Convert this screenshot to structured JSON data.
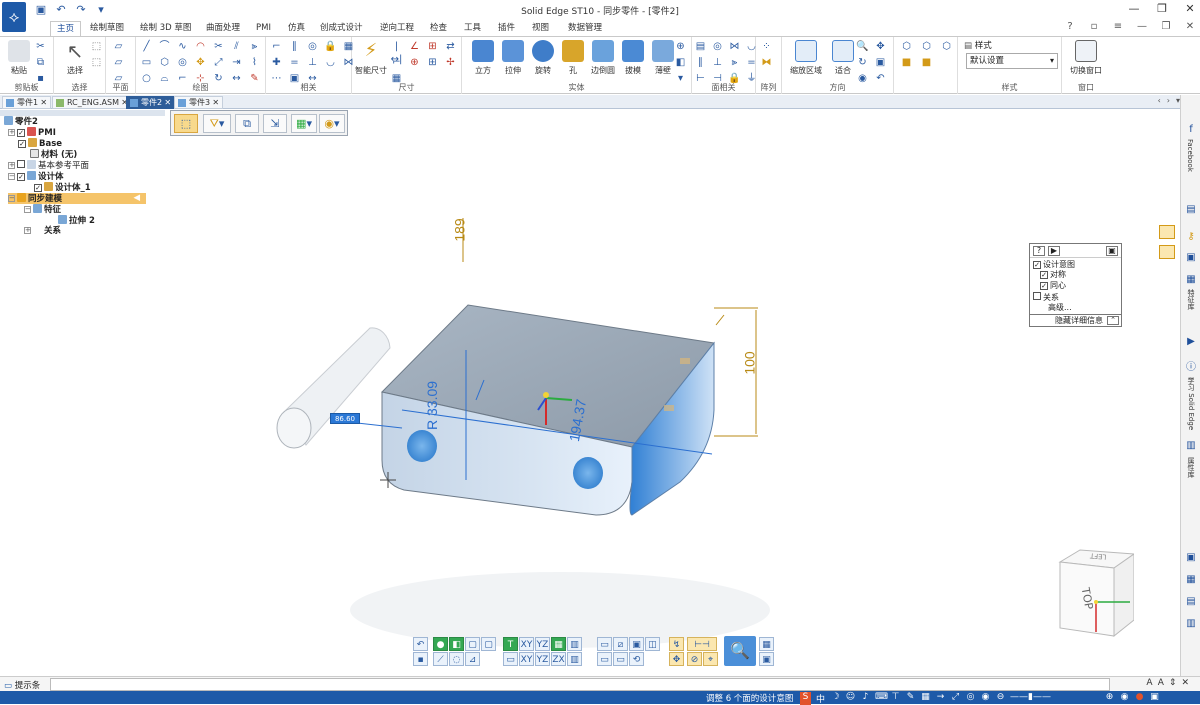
{
  "app": {
    "window_title": "Solid Edge ST10 - 同步零件 - [零件2]",
    "logo_icon": "solid-edge-logo"
  },
  "ribbon_tabs": [
    "主页",
    "绘制草图",
    "绘制 3D 草图",
    "曲面处理",
    "PMI",
    "仿真",
    "创成式设计",
    "逆向工程",
    "检查",
    "工具",
    "插件",
    "视图",
    "数据管理"
  ],
  "ribbon": {
    "groups": {
      "clipboard": "剪贴板",
      "select": "选择",
      "plane": "平面",
      "draw": "绘图",
      "relate": "相关",
      "dimension": "尺寸",
      "solid": "实体",
      "face_relate": "面相关",
      "pattern": "阵列",
      "orient": "方向",
      "style": "样式",
      "window": "窗口"
    },
    "buttons": {
      "paste": "粘贴",
      "select": "选择",
      "smart_dimension": "智能尺寸",
      "extrude_block": "立方",
      "pull": "拉伸",
      "revolve": "旋转",
      "hole": "孔",
      "round": "边倒圆",
      "loft": "拔模",
      "thin_wall": "薄壁",
      "zoom_area": "缩放区域",
      "fit": "适合",
      "style_label": "样式",
      "switch_window": "切换窗口"
    },
    "style_select_value": "默认设置"
  },
  "doc_tabs": [
    {
      "label": "零件1",
      "active": false
    },
    {
      "label": "RC_ENG.ASM",
      "active": false
    },
    {
      "label": "零件2",
      "active": true
    },
    {
      "label": "零件3",
      "active": false
    }
  ],
  "tree": {
    "root": "零件2",
    "items": [
      {
        "label": "PMI",
        "depth": 1
      },
      {
        "label": "Base",
        "depth": 1
      },
      {
        "label": "材料 (无)",
        "depth": 1
      },
      {
        "label": "基本参考平面",
        "depth": 1
      },
      {
        "label": "设计体",
        "depth": 1
      },
      {
        "label": "设计体_1",
        "depth": 2
      },
      {
        "label": "同步建模",
        "depth": 1
      },
      {
        "label": "特征",
        "depth": 2
      },
      {
        "label": "拉伸 2",
        "depth": 3
      },
      {
        "label": "关系",
        "depth": 2
      }
    ]
  },
  "dimensions": {
    "top_height": "189",
    "height": "100",
    "radius": "R 33.09",
    "length": "194.37",
    "input_value": "86.60"
  },
  "design_intent": {
    "title": "设计意图",
    "items": [
      "对称",
      "同心",
      "关系",
      "高级..."
    ],
    "hide_details": "隐藏详细信息"
  },
  "view_cube": {
    "top_label": "TOP",
    "left_label": "LEFT"
  },
  "right_bar": {
    "labels": [
      "Facebook",
      "特征库",
      "学习 Solid Edge",
      "属性库"
    ]
  },
  "prompt_bar": {
    "label": "提示条"
  },
  "status_bar": {
    "text": "调整 6 个面的设计意图"
  },
  "colors": {
    "accent": "#1e5aa8",
    "tree_selection": "#f5c46a",
    "dimension_blue": "#2b6fd0",
    "dimension_gold": "#b88a15",
    "part_face": "#9fb3c8"
  }
}
